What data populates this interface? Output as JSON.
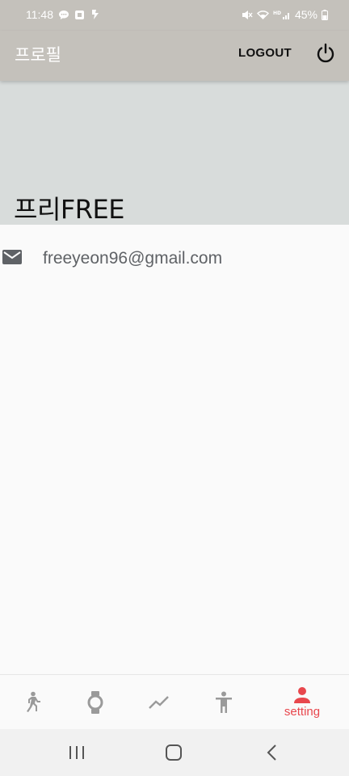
{
  "status_bar": {
    "time": "11:48",
    "battery": "45%",
    "icons_left": [
      "chat-bubble-icon",
      "square-app-icon",
      "brush-app-icon"
    ],
    "icons_right": [
      "mute-icon",
      "wifi-icon",
      "hd-signal-icon",
      "battery-icon"
    ]
  },
  "app_bar": {
    "title": "프로필",
    "logout_label": "LOGOUT",
    "power_icon": "power-icon",
    "background": "#c4c1bb"
  },
  "profile": {
    "name": "프리FREE",
    "email": "freeyeon96@gmail.com",
    "email_icon": "mail-icon",
    "header_color": "#d8dcdb"
  },
  "bottom_nav": {
    "accent": "#e8474d",
    "inactive": "#9a9a9a",
    "items": [
      {
        "icon": "walk-icon",
        "label": ""
      },
      {
        "icon": "watch-icon",
        "label": ""
      },
      {
        "icon": "trend-icon",
        "label": ""
      },
      {
        "icon": "person-stretch-icon",
        "label": ""
      },
      {
        "icon": "person-icon",
        "label": "setting",
        "active": true
      }
    ]
  },
  "system_nav": {
    "buttons": [
      "recent-apps-icon",
      "home-icon",
      "back-icon"
    ]
  }
}
